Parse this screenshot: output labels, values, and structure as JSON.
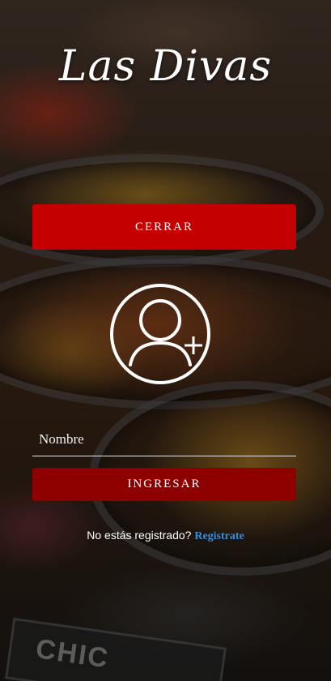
{
  "app": {
    "title": "Las Divas"
  },
  "background": {
    "sign_text": "CHIC"
  },
  "buttons": {
    "close_label": "CERRAR",
    "login_label": "INGRESAR"
  },
  "form": {
    "name_placeholder": "Nombre",
    "name_value": ""
  },
  "register": {
    "prompt": "No estás registrado?",
    "link_label": "Registrate"
  },
  "icons": {
    "avatar": "user-plus-icon"
  },
  "colors": {
    "close_button": "#c40000",
    "login_button": "#8e0000",
    "link": "#3a8bd6"
  }
}
